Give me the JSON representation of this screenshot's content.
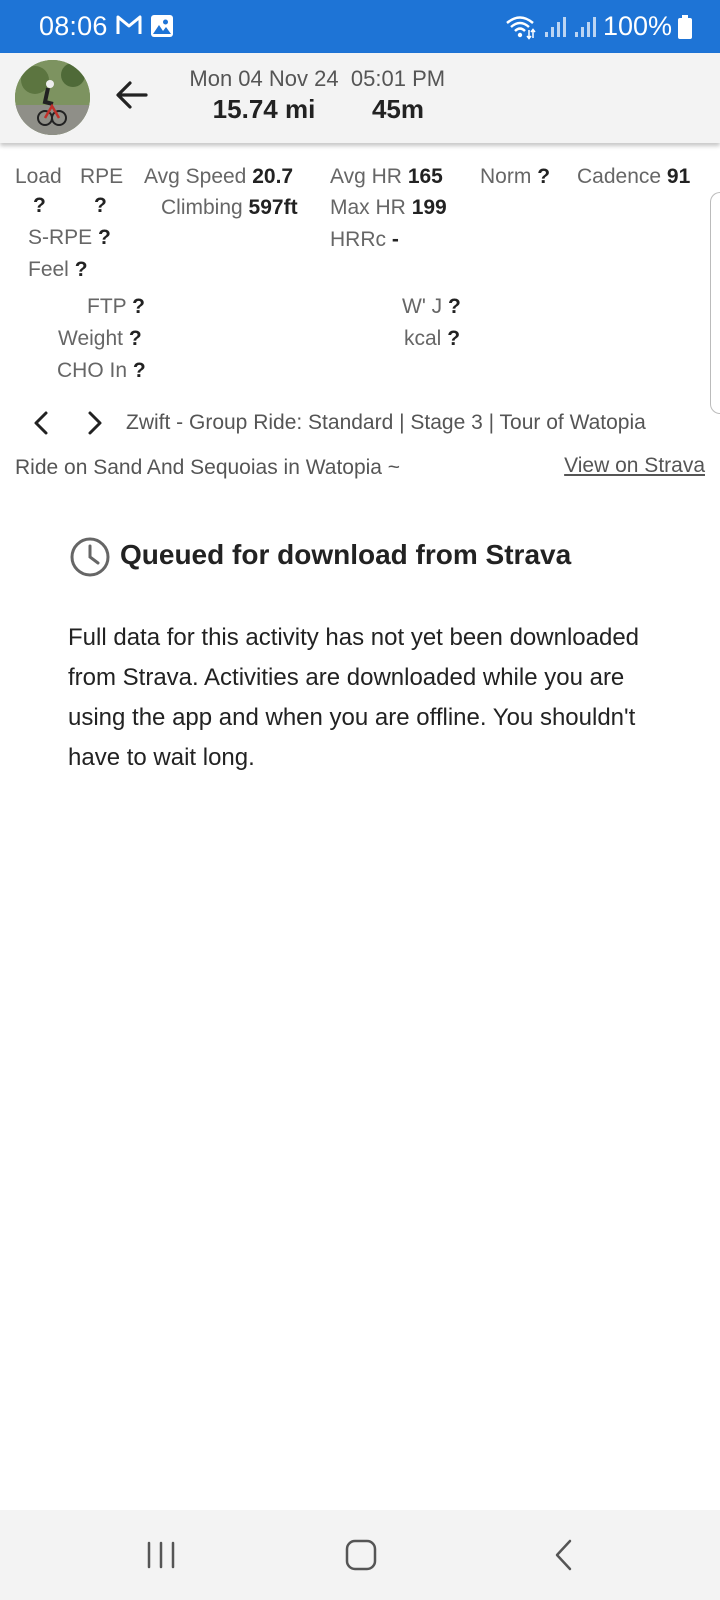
{
  "status_bar": {
    "time": "08:06",
    "notification_icons": [
      "gmail-icon",
      "image-icon"
    ],
    "battery_text": "100%",
    "bg_color": "#1e74d6"
  },
  "header": {
    "date": "Mon 04 Nov 24",
    "distance": "15.74 mi",
    "start_time": "05:01 PM",
    "duration": "45m"
  },
  "metrics": {
    "load_label": "Load",
    "load_value": "?",
    "rpe_label": "RPE",
    "rpe_value": "?",
    "srpe_label": "S-RPE",
    "srpe_value": "?",
    "feel_label": "Feel",
    "feel_value": "?",
    "avg_speed_label": "Avg Speed",
    "avg_speed_value": "20.7",
    "climbing_label": "Climbing",
    "climbing_value": "597ft",
    "avg_hr_label": "Avg HR",
    "avg_hr_value": "165",
    "max_hr_label": "Max HR",
    "max_hr_value": "199",
    "hrrc_label": "HRRc",
    "hrrc_value": "-",
    "norm_label": "Norm",
    "norm_value": "?",
    "cadence_label": "Cadence",
    "cadence_value": "91",
    "ftp_label": "FTP",
    "ftp_value": "?",
    "weight_label": "Weight",
    "weight_value": "?",
    "cho_label": "CHO In",
    "cho_value": "?",
    "wj_label": "W' J",
    "wj_value": "?",
    "kcal_label": "kcal",
    "kcal_value": "?"
  },
  "activity": {
    "title": "Zwift - Group Ride: Standard | Stage 3 | Tour of Watopia",
    "description": "Ride on Sand And Sequoias in Watopia ~",
    "strava_link": "View on Strava"
  },
  "queued": {
    "title": "Queued for download from Strava",
    "body": "Full data for this activity has not yet been downloaded from Strava. Activities are downloaded while you are using the app and when you are offline. You shouldn't have to wait long."
  }
}
